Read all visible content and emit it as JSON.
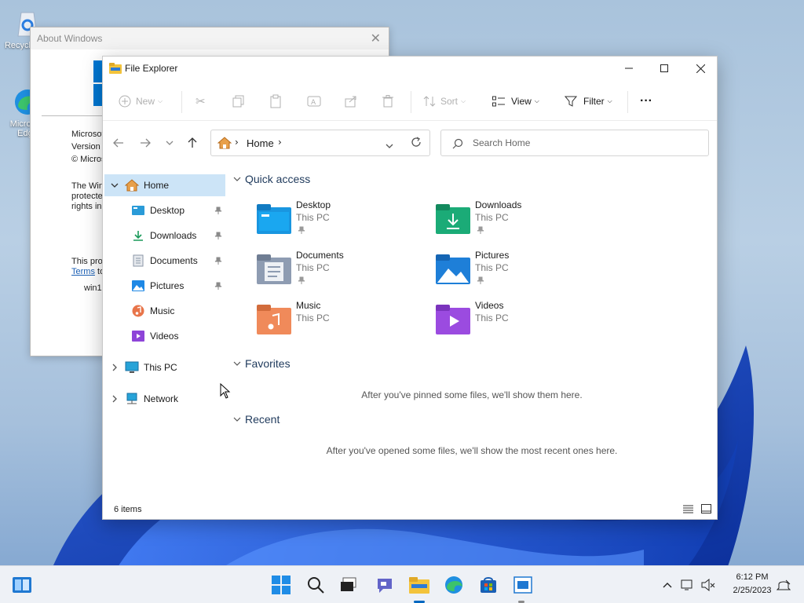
{
  "desktop": {
    "icons": [
      {
        "label": "Recycle Bin",
        "icon": "recycle-bin-icon"
      },
      {
        "label": "Microsoft Edge",
        "icon": "edge-icon"
      }
    ]
  },
  "about_dialog": {
    "title": "About Windows",
    "lines": [
      "Microsof",
      "Version",
      "© Micros",
      "The Win",
      "protecte",
      "rights in",
      "This pro",
      "Terms",
      "to",
      "win1"
    ]
  },
  "explorer": {
    "title": "File Explorer",
    "toolbar": {
      "new_label": "New",
      "sort_label": "Sort",
      "view_label": "View",
      "filter_label": "Filter",
      "more_label": "···"
    },
    "address": {
      "crumb": "Home"
    },
    "search": {
      "placeholder": "Search Home"
    },
    "sidebar": {
      "home": "Home",
      "items": [
        {
          "label": "Desktop",
          "icon": "desktop-folder-icon"
        },
        {
          "label": "Downloads",
          "icon": "downloads-icon"
        },
        {
          "label": "Documents",
          "icon": "documents-icon"
        },
        {
          "label": "Pictures",
          "icon": "pictures-icon"
        },
        {
          "label": "Music",
          "icon": "music-icon"
        },
        {
          "label": "Videos",
          "icon": "videos-icon"
        }
      ],
      "this_pc": "This PC",
      "network": "Network"
    },
    "sections": {
      "quick_access": "Quick access",
      "favorites": "Favorites",
      "recent": "Recent"
    },
    "quick_access": [
      {
        "name": "Desktop",
        "location": "This PC"
      },
      {
        "name": "Downloads",
        "location": "This PC"
      },
      {
        "name": "Documents",
        "location": "This PC"
      },
      {
        "name": "Pictures",
        "location": "This PC"
      },
      {
        "name": "Music",
        "location": "This PC"
      },
      {
        "name": "Videos",
        "location": "This PC"
      }
    ],
    "favorites_empty": "After you've pinned some files, we'll show them here.",
    "recent_empty": "After you've opened some files, we'll show the most recent ones here.",
    "status": "6 items"
  },
  "taskbar": {
    "time": "6:12 PM",
    "date": "2/25/2023"
  },
  "colors": {
    "accent": "#0067c0",
    "selection": "#cce4f7",
    "folder_yellow": "#f3c33b"
  }
}
